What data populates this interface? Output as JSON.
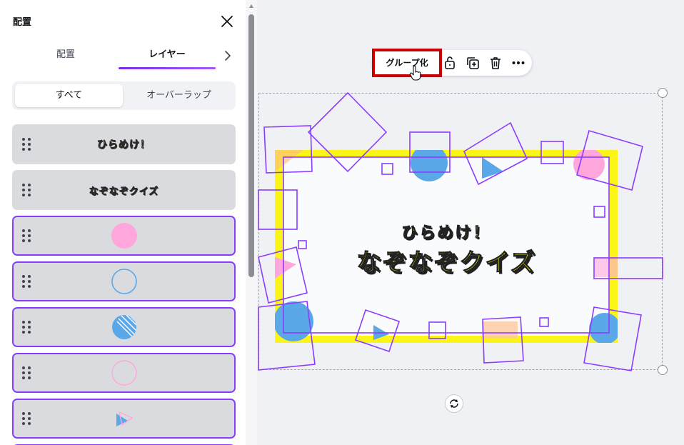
{
  "panel": {
    "title": "配置",
    "tabs": [
      {
        "label": "配置",
        "active": false
      },
      {
        "label": "レイヤー",
        "active": true
      }
    ],
    "filters": [
      {
        "label": "すべて",
        "active": true
      },
      {
        "label": "オーバーラップ",
        "active": false
      }
    ],
    "layers": [
      {
        "type": "text",
        "text": "ひらめけ！",
        "selected": false
      },
      {
        "type": "text",
        "text": "なぞなぞクイズ",
        "selected": false
      },
      {
        "type": "pink-circle",
        "selected": true
      },
      {
        "type": "blue-ring",
        "selected": true
      },
      {
        "type": "blue-pattern-circle",
        "selected": true
      },
      {
        "type": "pink-ring",
        "selected": true
      },
      {
        "type": "triangles",
        "selected": true
      }
    ]
  },
  "toolbar": {
    "group_label": "グループ化",
    "icons": [
      "lock-icon",
      "duplicate-icon",
      "trash-icon",
      "more-icon"
    ]
  },
  "design": {
    "title_line1": "ひらめけ！",
    "title_line2": "なぞなぞクイズ"
  },
  "colors": {
    "accent": "#8b3dff",
    "highlight": "#cc0000",
    "frame_yellow": "#fbf517",
    "pink": "#ffa7dc",
    "blue": "#5aa8e8"
  }
}
